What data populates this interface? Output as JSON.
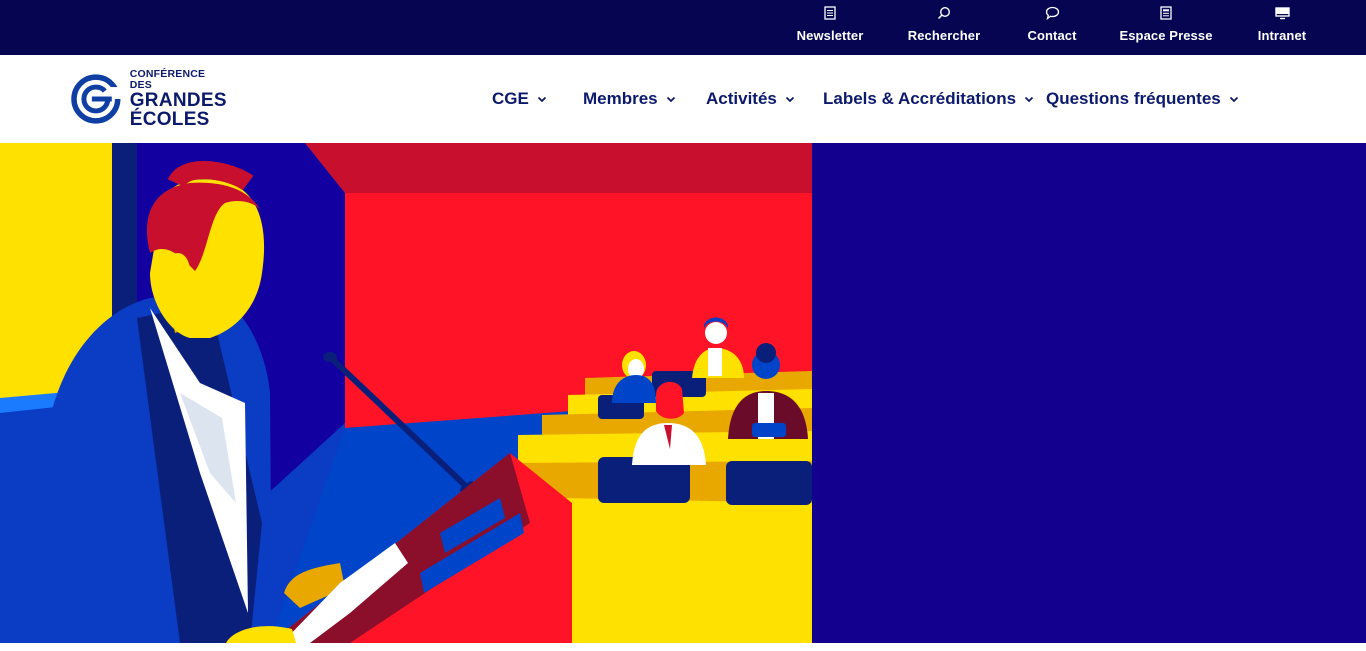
{
  "topbar": {
    "links": [
      {
        "label": "Newsletter",
        "icon": "newsletter-icon"
      },
      {
        "label": "Rechercher",
        "icon": "search-icon"
      },
      {
        "label": "Contact",
        "icon": "chat-bubble-icon"
      },
      {
        "label": "Espace Presse",
        "icon": "document-icon"
      },
      {
        "label": "Intranet",
        "icon": "monitor-icon"
      }
    ]
  },
  "logo": {
    "line1": "CONFÉRENCE DES",
    "line2": "GRANDES",
    "line3": "ÉCOLES"
  },
  "nav": {
    "items": [
      {
        "label": "CGE"
      },
      {
        "label": "Membres"
      },
      {
        "label": "Activités"
      },
      {
        "label": "Labels & Accréditations"
      },
      {
        "label": "Questions fréquentes"
      }
    ]
  },
  "colors": {
    "topbar_bg": "#050552",
    "brand_blue": "#0c1a6c",
    "hero_bg": "#14008e",
    "illustration_red": "#ff1427",
    "illustration_yellow": "#ffe100",
    "illustration_blue": "#0044c9"
  },
  "hero": {
    "illustration": "speaker-at-podium-conference-illustration"
  }
}
